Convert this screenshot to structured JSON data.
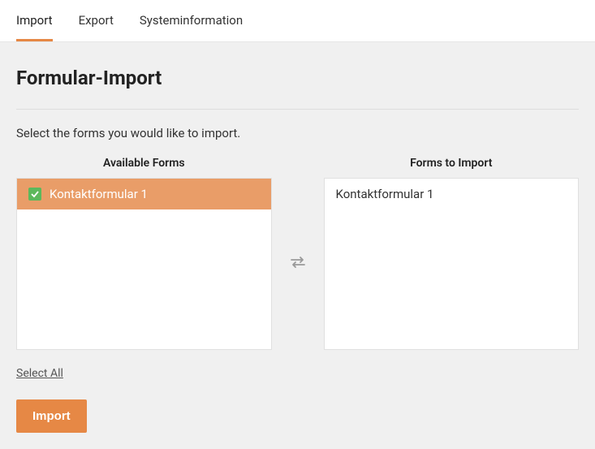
{
  "tabs": {
    "import": "Import",
    "export": "Export",
    "systeminfo": "Systeminformation"
  },
  "page_title": "Formular-Import",
  "instruction": "Select the forms you would like to import.",
  "columns": {
    "available_header": "Available Forms",
    "toimport_header": "Forms to Import"
  },
  "available_forms": [
    {
      "label": "Kontaktformular 1",
      "selected": true
    }
  ],
  "forms_to_import": [
    {
      "label": "Kontaktformular 1"
    }
  ],
  "select_all_label": "Select All",
  "import_button_label": "Import"
}
